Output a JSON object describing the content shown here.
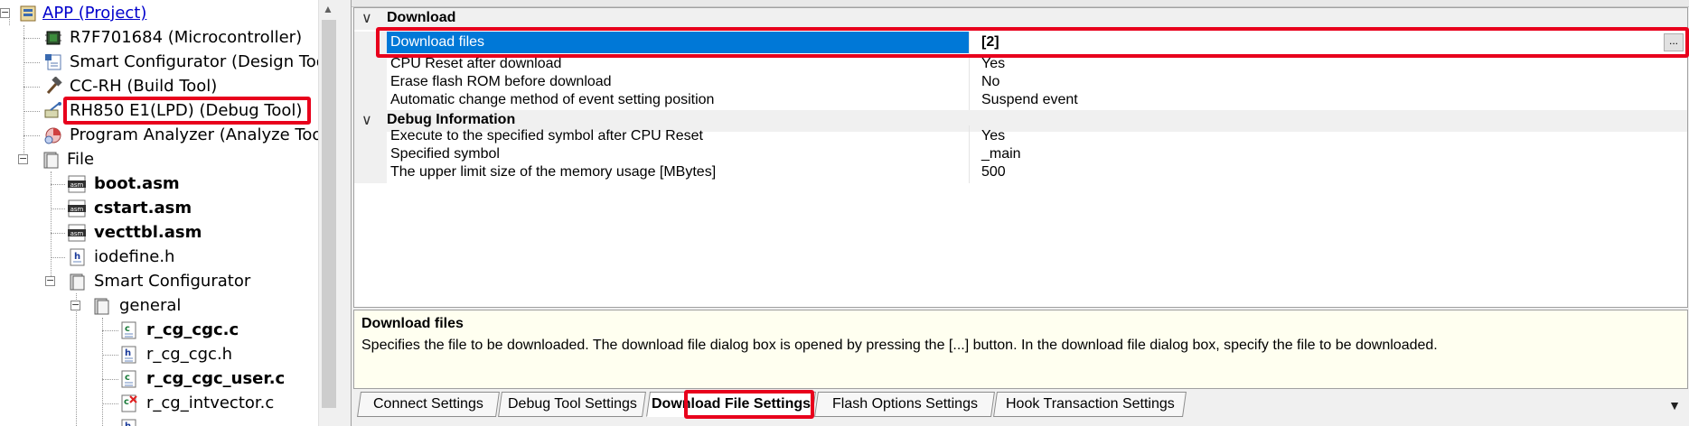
{
  "tree": {
    "items": [
      {
        "label": "APP (Project)",
        "icon": "project-icon"
      },
      {
        "label": "R7F701684 (Microcontroller)",
        "icon": "microcontroller-icon"
      },
      {
        "label": "Smart Configurator (Design Too",
        "icon": "design-tool-icon"
      },
      {
        "label": "CC-RH (Build Tool)",
        "icon": "build-tool-icon"
      },
      {
        "label": "RH850 E1(LPD) (Debug Tool)",
        "icon": "debug-tool-icon"
      },
      {
        "label": "Program Analyzer (Analyze Too",
        "icon": "analyzer-icon"
      },
      {
        "label": "File",
        "icon": "folder-icon"
      },
      {
        "label": "boot.asm",
        "icon": "asm-file-icon"
      },
      {
        "label": "cstart.asm",
        "icon": "asm-file-icon"
      },
      {
        "label": "vecttbl.asm",
        "icon": "asm-file-icon"
      },
      {
        "label": "iodefine.h",
        "icon": "h-file-icon"
      },
      {
        "label": "Smart Configurator",
        "icon": "folder-icon"
      },
      {
        "label": "general",
        "icon": "folder-icon"
      },
      {
        "label": "r_cg_cgc.c",
        "icon": "c-file-icon"
      },
      {
        "label": "r_cg_cgc.h",
        "icon": "h-file-icon"
      },
      {
        "label": "r_cg_cgc_user.c",
        "icon": "c-file-icon"
      },
      {
        "label": "r_cg_intvector.c",
        "icon": "c-file-excluded-icon"
      }
    ],
    "expander_minus": "−"
  },
  "grid": {
    "categories": {
      "download": "Download",
      "debug_information": "Debug Information"
    },
    "download_rows": [
      {
        "name": "Download files",
        "value": "[2]"
      },
      {
        "name": "CPU Reset after download",
        "value": "Yes"
      },
      {
        "name": "Erase flash ROM before download",
        "value": "No"
      },
      {
        "name": "Automatic change method of event setting position",
        "value": "Suspend event"
      }
    ],
    "debug_rows": [
      {
        "name": "Execute to the specified symbol after CPU Reset",
        "value": "Yes"
      },
      {
        "name": "Specified symbol",
        "value": "_main"
      },
      {
        "name": "The upper limit size of the memory usage [MBytes]",
        "value": "500"
      }
    ],
    "ellipsis_label": "..."
  },
  "description": {
    "title": "Download files",
    "text": "Specifies the file to be downloaded. The download file dialog box is opened by pressing the [...] button. In the download file dialog box, specify the file to be downloaded."
  },
  "tabs": [
    {
      "label": "Connect Settings"
    },
    {
      "label": "Debug Tool Settings"
    },
    {
      "label": "Download File Settings",
      "active": true
    },
    {
      "label": "Flash Options Settings"
    },
    {
      "label": "Hook Transaction Settings"
    }
  ],
  "colors": {
    "highlight": "#e8001c",
    "selection": "#0078d7",
    "description_bg": "#fffff0"
  }
}
